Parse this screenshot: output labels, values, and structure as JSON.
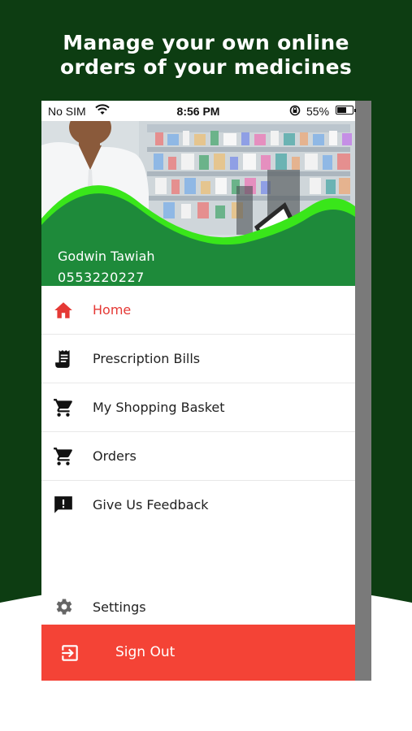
{
  "promo": {
    "headline_line1": "Manage your own online",
    "headline_line2": "orders of your medicines"
  },
  "status_bar": {
    "carrier": "No SIM",
    "time": "8:56 PM",
    "battery": "55%",
    "battery_level": 0.55
  },
  "profile": {
    "name": "Godwin Tawiah",
    "phone": "0553220227"
  },
  "menu": {
    "items": [
      {
        "label": "Home",
        "icon": "home-icon",
        "active": true
      },
      {
        "label": "Prescription Bills",
        "icon": "receipt-icon",
        "active": false
      },
      {
        "label": "My Shopping Basket",
        "icon": "cart-icon",
        "active": false
      },
      {
        "label": "Orders",
        "icon": "cart-icon",
        "active": false
      },
      {
        "label": "Give Us Feedback",
        "icon": "feedback-icon",
        "active": false
      }
    ],
    "settings_label": "Settings",
    "sign_out_label": "Sign Out"
  },
  "colors": {
    "background_dark_green": "#0d3d12",
    "header_green": "#1e8a3a",
    "wave_lime": "#39e61a",
    "active_red": "#e53935",
    "sign_out_red": "#f44336"
  }
}
